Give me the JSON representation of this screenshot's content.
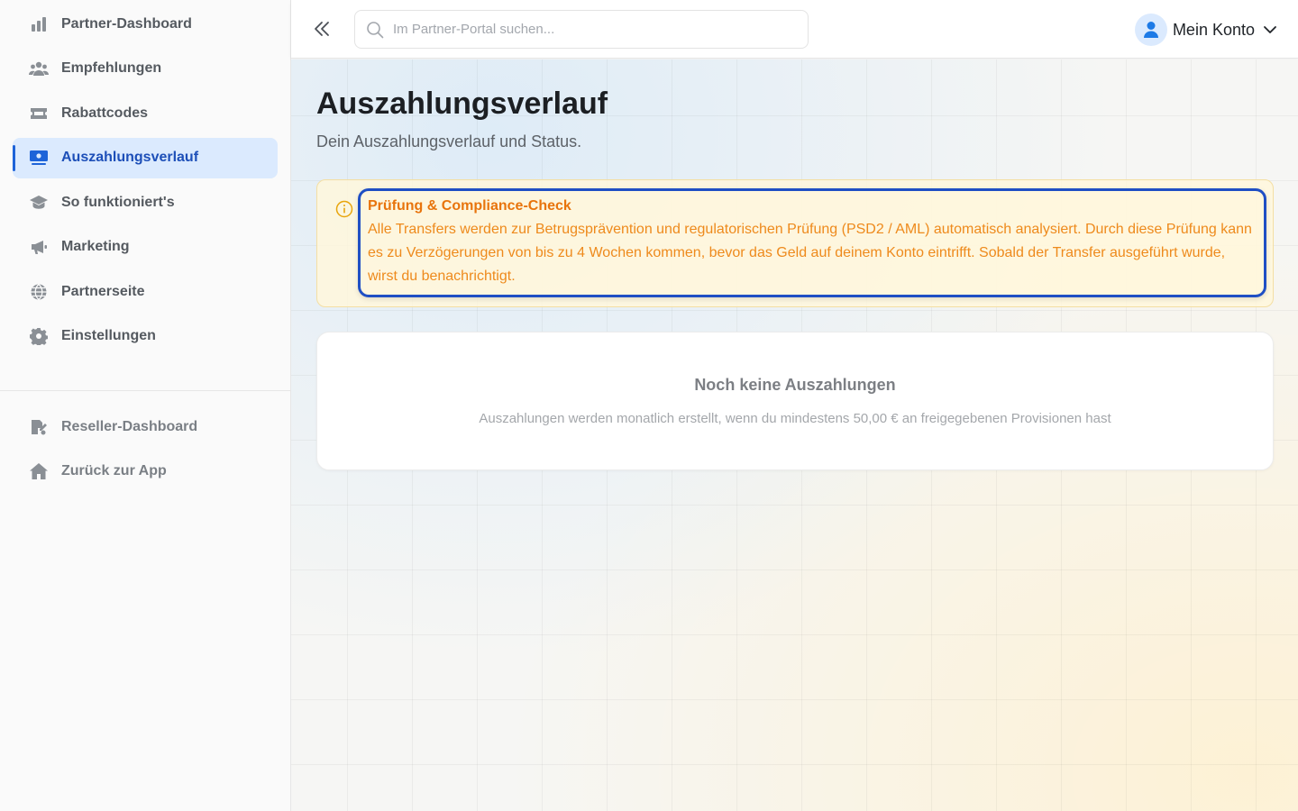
{
  "sidebar": {
    "items": [
      {
        "label": "Partner-Dashboard",
        "icon": "bar-chart-icon"
      },
      {
        "label": "Empfehlungen",
        "icon": "users-icon"
      },
      {
        "label": "Rabattcodes",
        "icon": "ticket-icon"
      },
      {
        "label": "Auszahlungsverlauf",
        "icon": "money-bill-icon",
        "active": true
      },
      {
        "label": "So funktioniert's",
        "icon": "graduation-cap-icon"
      },
      {
        "label": "Marketing",
        "icon": "megaphone-icon"
      },
      {
        "label": "Partnerseite",
        "icon": "globe-icon"
      },
      {
        "label": "Einstellungen",
        "icon": "gear-icon"
      }
    ],
    "secondary": [
      {
        "label": "Reseller-Dashboard",
        "icon": "reseller-icon"
      },
      {
        "label": "Zurück zur App",
        "icon": "home-icon"
      }
    ]
  },
  "header": {
    "search_placeholder": "Im Partner-Portal suchen...",
    "account_label": "Mein Konto"
  },
  "main": {
    "title": "Auszahlungsverlauf",
    "subtitle": "Dein Auszahlungsverlauf und Status.",
    "notice": {
      "title": "Prüfung & Compliance-Check",
      "text": "Alle Transfers werden zur Betrugsprävention und regulatorischen Prüfung (PSD2 / AML) automatisch analysiert. Durch diese Prüfung kann es zu Verzögerungen von bis zu 4 Wochen kommen, bevor das Geld auf deinem Konto eintrifft. Sobald der Transfer ausgeführt wurde, wirst du benachrichtigt."
    },
    "empty": {
      "title": "Noch keine Auszahlungen",
      "text": "Auszahlungen werden monatlich erstellt, wenn du mindestens 50,00 € an freigegebenen Provisionen hast"
    }
  },
  "colors": {
    "accent": "#1d63d8",
    "active_bg": "#dbeafe",
    "notice_text": "#ee8a1c",
    "notice_border": "#1f4fc4"
  }
}
